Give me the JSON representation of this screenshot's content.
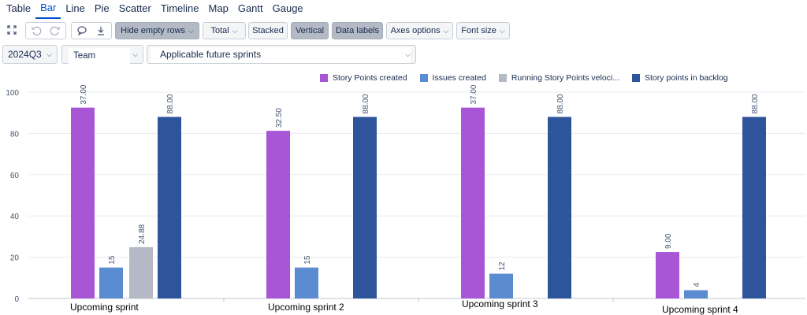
{
  "view_tabs": [
    "Table",
    "Bar",
    "Line",
    "Pie",
    "Scatter",
    "Timeline",
    "Map",
    "Gantt",
    "Gauge"
  ],
  "active_tab": "Bar",
  "toolbar": {
    "hide_empty_rows": "Hide empty rows",
    "total": "Total",
    "stacked": "Stacked",
    "vertical": "Vertical",
    "data_labels": "Data labels",
    "axes_options": "Axes options",
    "font_size": "Font size",
    "icons": [
      "fullscreen-icon",
      "undo-icon",
      "redo-icon",
      "comment-icon",
      "export-icon"
    ]
  },
  "filters": {
    "period": "2024Q3",
    "team": "Team",
    "sprints": "Applicable future sprints"
  },
  "colors": {
    "accent": "#0052cc",
    "story_points_created": "#a855d6",
    "issues_created": "#5b8bd0",
    "running_velocity": "#b3bac5",
    "backlog": "#2e559b"
  },
  "chart_data": {
    "type": "bar",
    "categories": [
      "Upcoming sprint",
      "Upcoming sprint 2",
      "Upcoming sprint 3",
      "Upcoming sprint 4"
    ],
    "series": [
      {
        "name": "Story Points created",
        "color": "#a855d6",
        "values": [
          92.5,
          81.25,
          92.5,
          22.5
        ],
        "labels": [
          "37.00",
          "32.50",
          "37.00",
          "9.00"
        ]
      },
      {
        "name": "Issues created",
        "color": "#5b8bd0",
        "values": [
          15,
          15,
          12,
          4
        ],
        "labels": [
          "15",
          "15",
          "12",
          "4"
        ]
      },
      {
        "name": "Running Story Points veloci...",
        "color": "#b3bac5",
        "values": [
          24.88,
          null,
          null,
          null
        ],
        "labels": [
          "24.88",
          "",
          "",
          ""
        ]
      },
      {
        "name": "Story points in backlog",
        "color": "#2e559b",
        "values": [
          88,
          88,
          88,
          88
        ],
        "labels": [
          "88.00",
          "88.00",
          "88.00",
          "88.00"
        ]
      }
    ],
    "ylim": [
      0,
      100
    ],
    "yticks": [
      0,
      20,
      40,
      60,
      80,
      100
    ],
    "grid": true,
    "legend_position": "top-right",
    "xlabel": "",
    "ylabel": ""
  }
}
